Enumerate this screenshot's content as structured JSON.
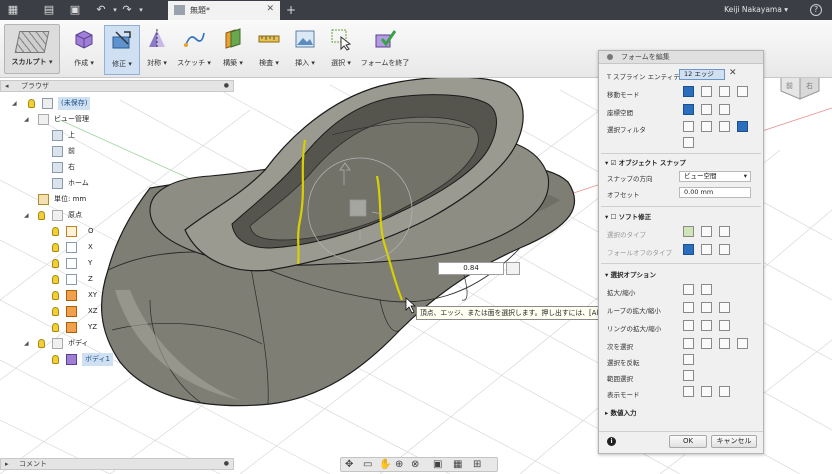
{
  "titlebar": {
    "doc_tab": "無題*",
    "user": "Keiji Nakayama ▾",
    "help": "?",
    "plus": "+"
  },
  "toolbar": {
    "workspace": "スカルプト ▾",
    "tools": [
      {
        "label": "作成 ▾"
      },
      {
        "label": "修正 ▾"
      },
      {
        "label": "対称 ▾"
      },
      {
        "label": "スケッチ ▾"
      },
      {
        "label": "構築 ▾"
      },
      {
        "label": "検査 ▾"
      },
      {
        "label": "挿入 ▾"
      },
      {
        "label": "選択 ▾"
      },
      {
        "label": "フォームを終了"
      }
    ]
  },
  "browser": {
    "title": "ブラウザ",
    "root": "(未保存)",
    "items": {
      "views": "ビュー管理",
      "top": "上",
      "front": "前",
      "right": "右",
      "home": "ホーム",
      "units": "単位: mm",
      "origin": "原点",
      "o": "O",
      "x": "X",
      "y": "Y",
      "z": "Z",
      "xy": "XY",
      "xz": "XZ",
      "yz": "YZ",
      "bodies": "ボディ",
      "body": "ボディ1"
    }
  },
  "panel": {
    "title": "フォームを編集",
    "tspline_label": "T スプライン エンティティ",
    "tspline_value": "12 エッジ",
    "move_mode": "移動モード",
    "coord_space": "座標空間",
    "sel_filter": "選択フィルタ",
    "object_snap": "オブジェクト スナップ",
    "snap_dir": "スナップの方向",
    "snap_dir_value": "ビュー空間",
    "offset": "オフセット",
    "offset_value": "0.00 mm",
    "soft_mod": "ソフト修正",
    "sel_type": "選択のタイプ",
    "falloff_type": "フォールオフのタイプ",
    "sel_options": "選択オプション",
    "grow_shrink": "拡大/縮小",
    "loop_grow": "ループの拡大/縮小",
    "ring_grow": "リングの拡大/縮小",
    "next": "次を選択",
    "invert": "選択を反転",
    "range": "範囲選択",
    "display_mode": "表示モード",
    "numeric": "数値入力",
    "ok": "OK",
    "cancel": "キャンセル",
    "info": "i"
  },
  "viewport": {
    "value": "0.84",
    "tooltip": "頂点、エッジ、または面を選択します。押し出すには、[Alt]キーを押します",
    "cube_top": "上",
    "cube_front": "前",
    "cube_right": "右"
  },
  "comments": {
    "title": "コメント"
  },
  "colors": {
    "selected_edge": "#d8d000",
    "accent": "#2a6ebd",
    "topbar": "#3b3f45"
  }
}
